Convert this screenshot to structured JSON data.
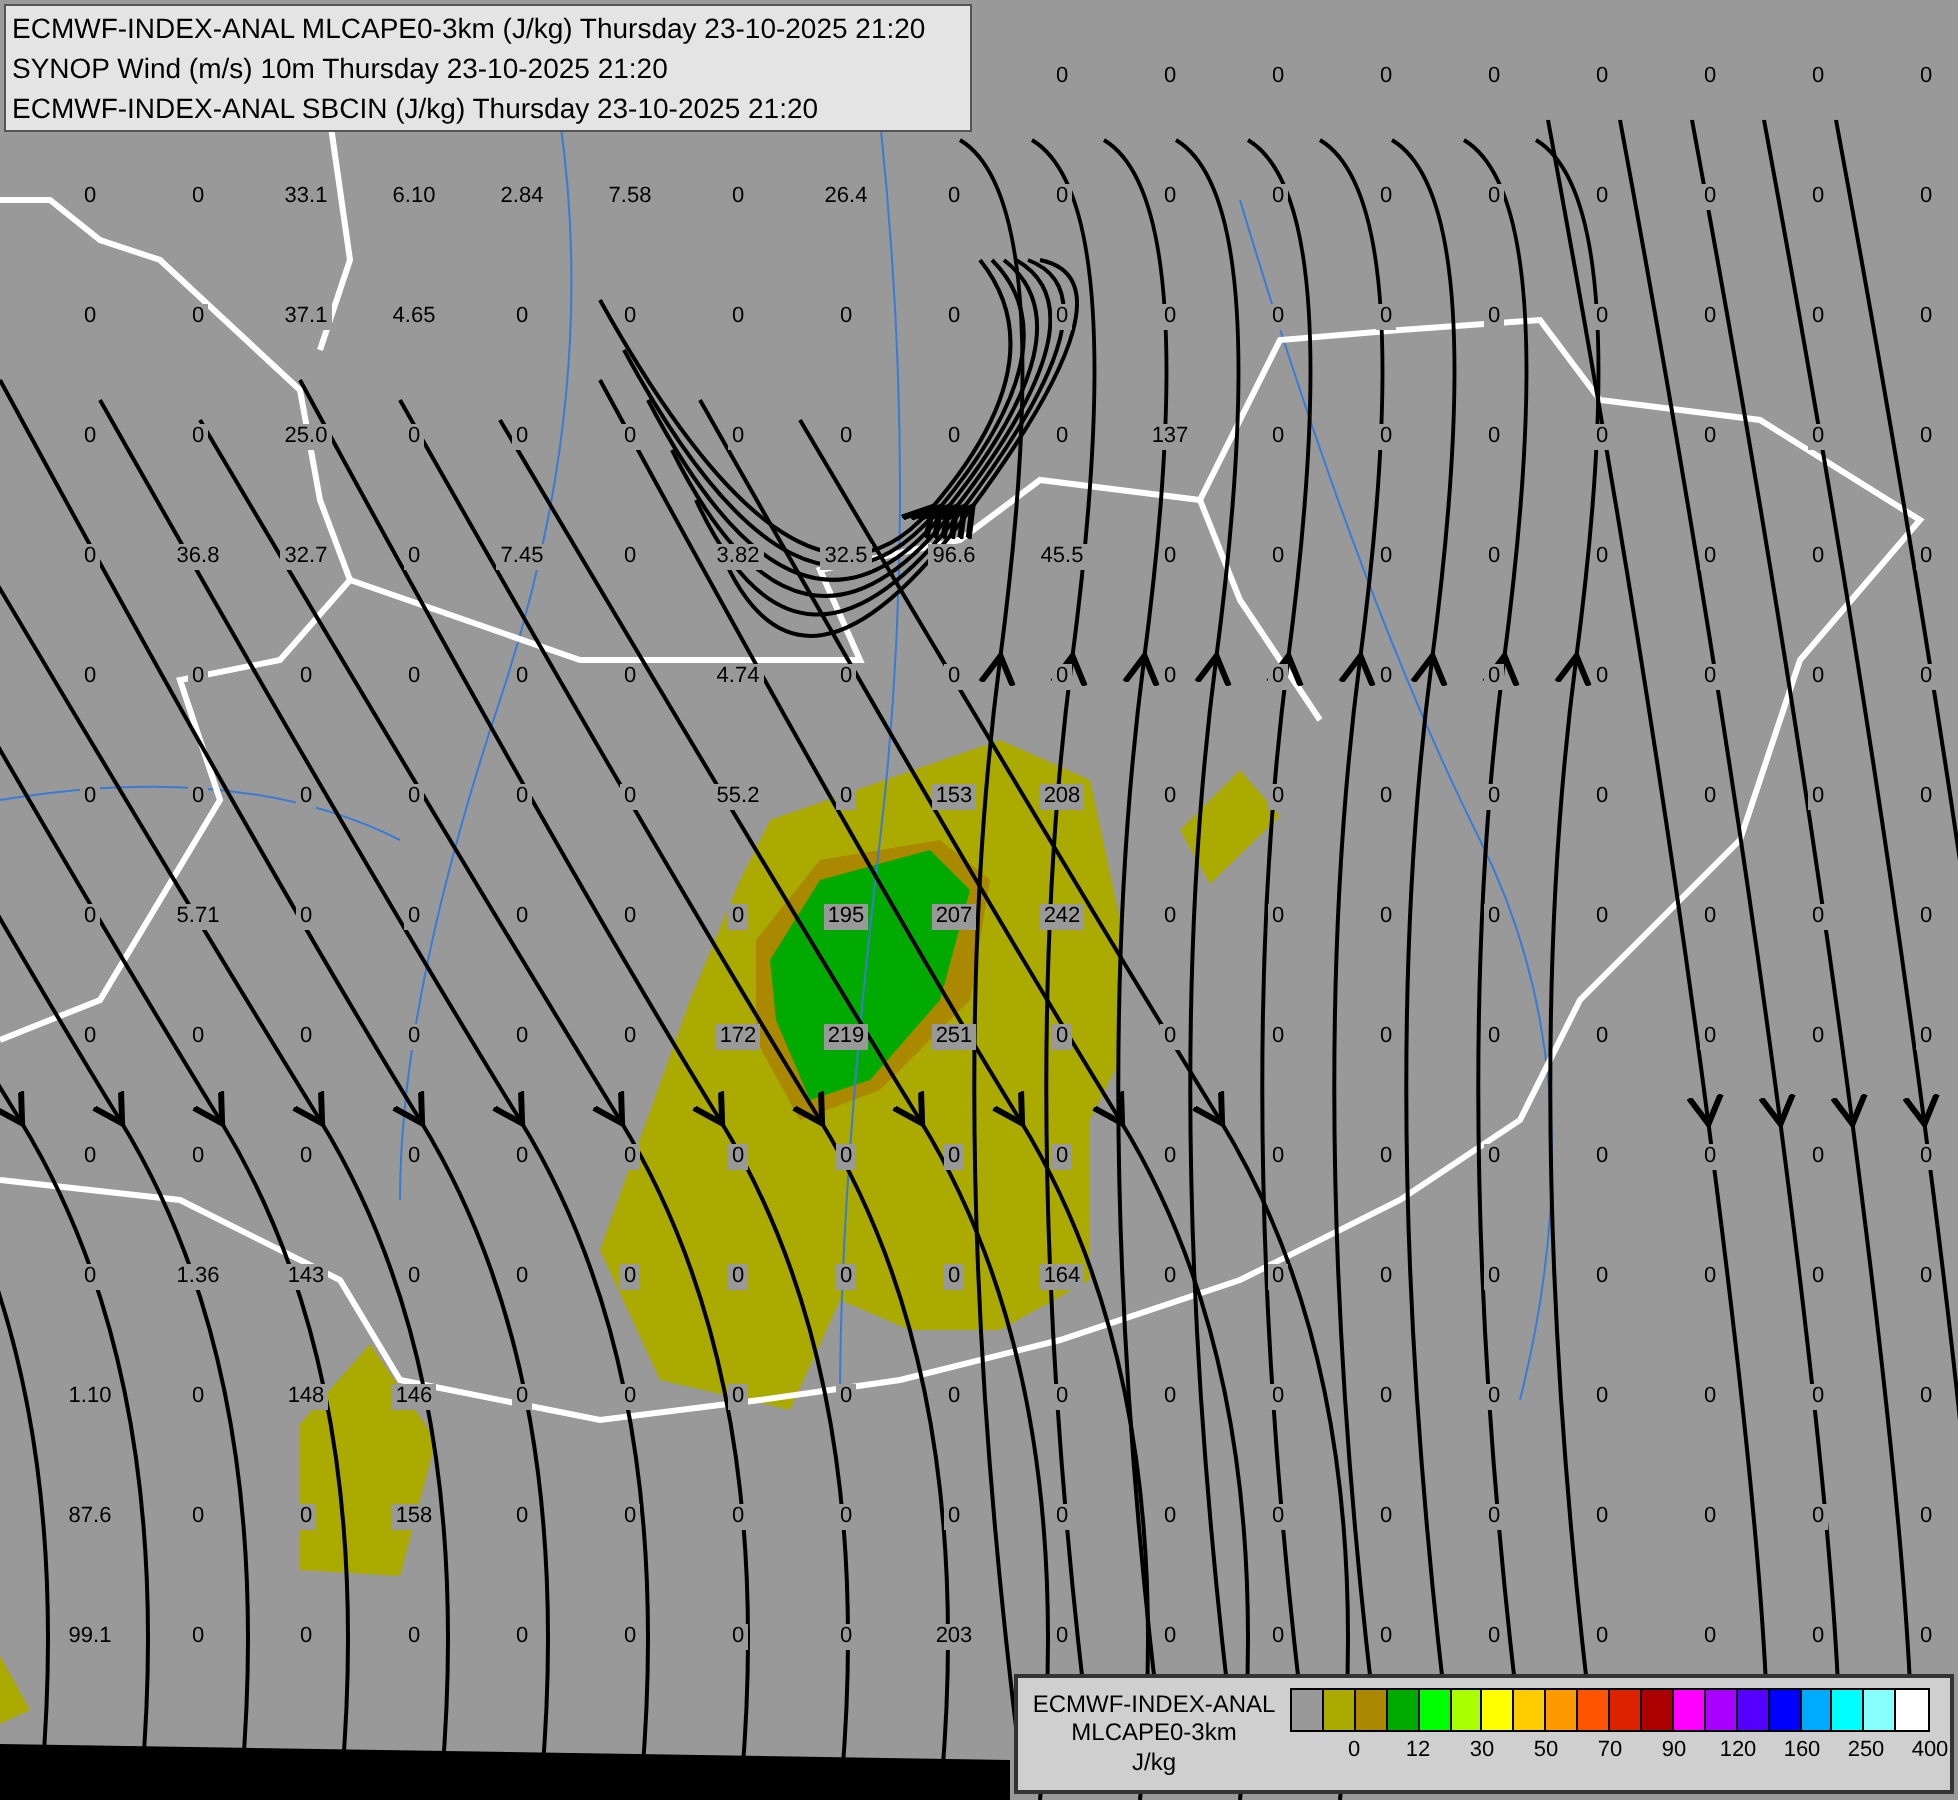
{
  "header": {
    "lines": [
      "ECMWF-INDEX-ANAL MLCAPE0-3km (J/kg) Thursday 23-10-2025 21:20",
      "SYNOP Wind (m/s) 10m Thursday 23-10-2025 21:20",
      "ECMWF-INDEX-ANAL SBCIN (J/kg) Thursday 23-10-2025 21:20"
    ]
  },
  "map": {
    "station_values": [
      [
        "0",
        "0",
        "0",
        "0",
        "0",
        "0",
        "0",
        "0",
        "0"
      ],
      [
        "0",
        "0",
        "33.1",
        "6.10",
        "2.84",
        "7.58",
        "0",
        "26.4",
        "0",
        "0",
        "0",
        "0",
        "0",
        "0",
        "0",
        "0",
        "0",
        "0"
      ],
      [
        "0",
        "0",
        "37.1",
        "4.65",
        "0",
        "0",
        "0",
        "0",
        "0",
        "0",
        "0",
        "0",
        "0",
        "0",
        "0",
        "0",
        "0",
        "0"
      ],
      [
        "0",
        "0",
        "25.0",
        "0",
        "0",
        "0",
        "0",
        "0",
        "0",
        "0",
        "137",
        "0",
        "0",
        "0",
        "0",
        "0",
        "0",
        "0"
      ],
      [
        "0",
        "36.8",
        "32.7",
        "0",
        "7.45",
        "0",
        "3.82",
        "32.5",
        "96.6",
        "45.5",
        "0",
        "0",
        "0",
        "0",
        "0",
        "0",
        "0",
        "0"
      ],
      [
        "0",
        "0",
        "0",
        "0",
        "0",
        "0",
        "4.74",
        "0",
        "0",
        "0",
        "0",
        "0",
        "0",
        "0",
        "0",
        "0",
        "0",
        "0"
      ],
      [
        "0",
        "0",
        "0",
        "0",
        "0",
        "0",
        "55.2",
        "0",
        "153",
        "208",
        "0",
        "0",
        "0",
        "0",
        "0",
        "0",
        "0",
        "0"
      ],
      [
        "0",
        "5.71",
        "0",
        "0",
        "0",
        "0",
        "0",
        "195",
        "207",
        "242",
        "0",
        "0",
        "0",
        "0",
        "0",
        "0",
        "0",
        "0"
      ],
      [
        "0",
        "0",
        "0",
        "0",
        "0",
        "0",
        "172",
        "219",
        "251",
        "0",
        "0",
        "0",
        "0",
        "0",
        "0",
        "0",
        "0",
        "0"
      ],
      [
        "0",
        "0",
        "0",
        "0",
        "0",
        "0",
        "0",
        "0",
        "0",
        "0",
        "0",
        "0",
        "0",
        "0",
        "0",
        "0",
        "0",
        "0"
      ],
      [
        "0",
        "1.36",
        "143",
        "0",
        "0",
        "0",
        "0",
        "0",
        "0",
        "164",
        "0",
        "0",
        "0",
        "0",
        "0",
        "0",
        "0",
        "0"
      ],
      [
        "1.10",
        "0",
        "148",
        "146",
        "0",
        "0",
        "0",
        "0",
        "0",
        "0",
        "0",
        "0",
        "0",
        "0",
        "0",
        "0",
        "0",
        "0"
      ],
      [
        "87.6",
        "0",
        "0",
        "158",
        "0",
        "0",
        "0",
        "0",
        "0",
        "0",
        "0",
        "0",
        "0",
        "0",
        "0",
        "0",
        "0",
        "0"
      ],
      [
        "99.1",
        "0",
        "0",
        "0",
        "0",
        "0",
        "0",
        "0",
        "203",
        "0",
        "0",
        "0",
        "0",
        "0",
        "0",
        "0",
        "0",
        "0"
      ]
    ]
  },
  "legend": {
    "title_lines": [
      "ECMWF-INDEX-ANAL",
      "MLCAPE0-3km"
    ],
    "unit": "J/kg",
    "swatches": [
      {
        "color": "#999999"
      },
      {
        "color": "#aaaa00"
      },
      {
        "color": "#aa8800"
      },
      {
        "color": "#00aa00"
      },
      {
        "color": "#00ff00"
      },
      {
        "color": "#aaff00"
      },
      {
        "color": "#ffff00"
      },
      {
        "color": "#ffcc00"
      },
      {
        "color": "#ff9900"
      },
      {
        "color": "#ff5500"
      },
      {
        "color": "#dd2200"
      },
      {
        "color": "#aa0000"
      },
      {
        "color": "#ff00ff"
      },
      {
        "color": "#aa00ff"
      },
      {
        "color": "#5500ff"
      },
      {
        "color": "#0000ff"
      },
      {
        "color": "#00aaff"
      },
      {
        "color": "#00ffff"
      },
      {
        "color": "#88ffff"
      },
      {
        "color": "#ffffff"
      }
    ],
    "ticks": [
      "0",
      "12",
      "30",
      "50",
      "70",
      "90",
      "120",
      "160",
      "250",
      "400"
    ]
  }
}
